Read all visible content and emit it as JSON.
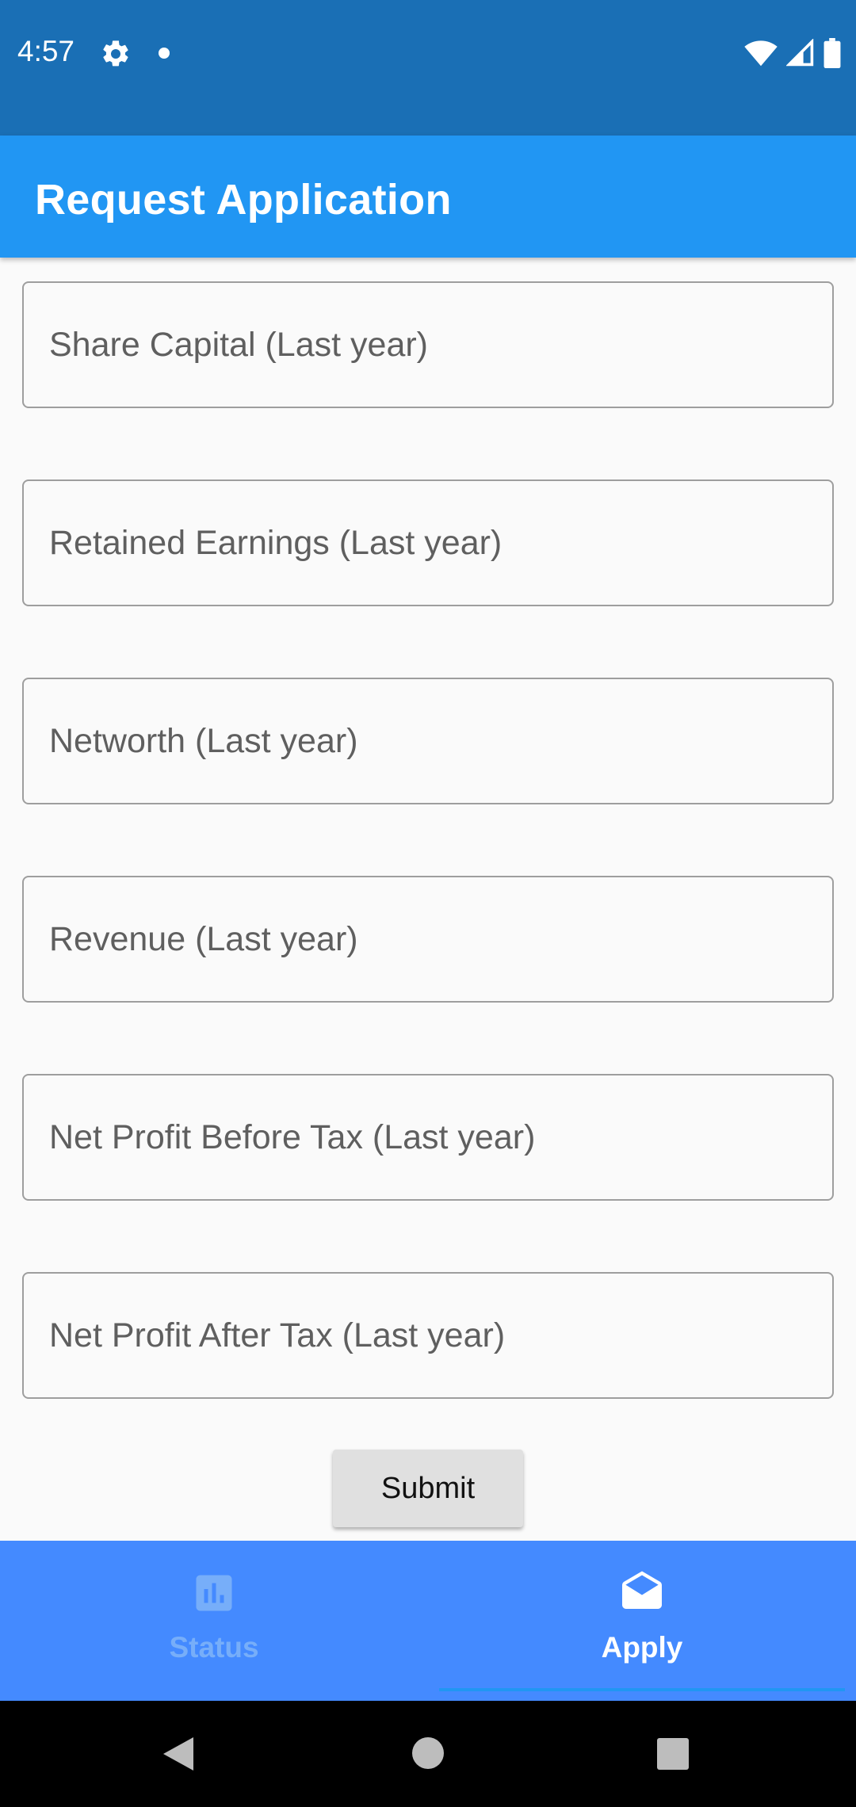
{
  "status_bar": {
    "time": "4:57",
    "icons": [
      "gear-icon",
      "notification-dot-icon",
      "wifi-icon",
      "signal-icon",
      "battery-icon"
    ]
  },
  "app_bar": {
    "title": "Request Application",
    "color": "#2196f3"
  },
  "form": {
    "fields": [
      {
        "placeholder": "Share Capital (Last year)",
        "value": ""
      },
      {
        "placeholder": "Retained Earnings (Last year)",
        "value": ""
      },
      {
        "placeholder": "Networth (Last year)",
        "value": ""
      },
      {
        "placeholder": "Revenue (Last year)",
        "value": ""
      },
      {
        "placeholder": "Net Profit Before Tax (Last year)",
        "value": ""
      },
      {
        "placeholder": "Net Profit After Tax (Last year)",
        "value": ""
      }
    ],
    "submit_label": "Submit"
  },
  "bottom_nav": {
    "color": "#448aff",
    "items": [
      {
        "label": "Status",
        "icon": "bar-chart-icon",
        "selected": false
      },
      {
        "label": "Apply",
        "icon": "mail-open-icon",
        "selected": true
      }
    ]
  },
  "system_nav": {
    "icons": [
      "back-icon",
      "home-icon",
      "recents-icon"
    ]
  }
}
